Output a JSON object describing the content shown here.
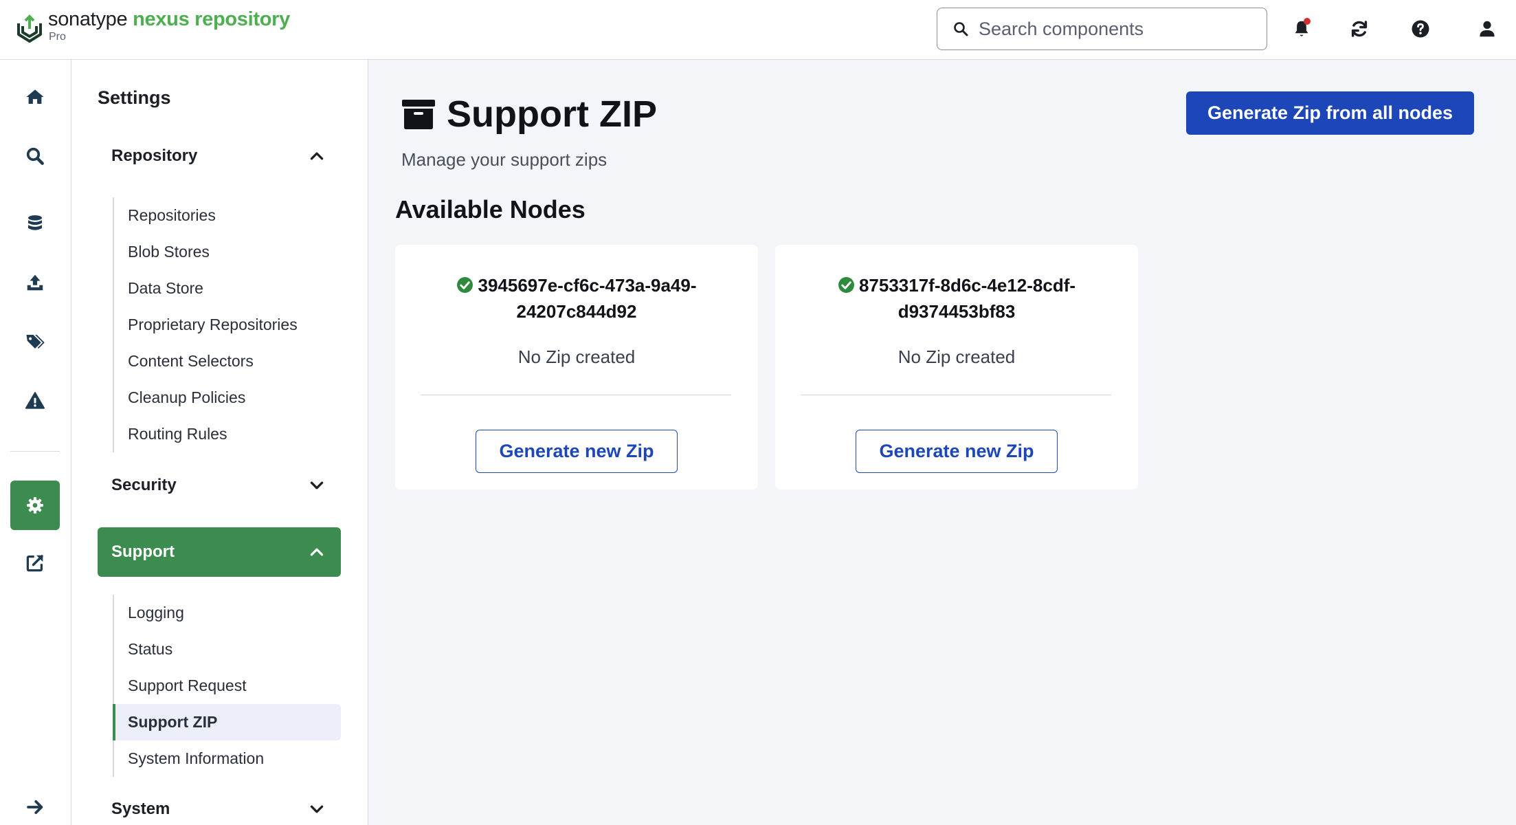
{
  "app": {
    "brand_part1": "sonatype",
    "brand_part2": "nexus repository",
    "edition": "Pro"
  },
  "header": {
    "search_placeholder": "Search components",
    "icons": [
      "bell-icon",
      "refresh-icon",
      "help-icon",
      "user-icon"
    ]
  },
  "rail": {
    "icons": [
      "home-icon",
      "search-icon",
      "database-icon",
      "upload-icon",
      "tags-icon",
      "warning-icon",
      "gear-icon",
      "external-link-icon",
      "arrow-right-icon"
    ],
    "active": "gear-icon"
  },
  "sidebar": {
    "title": "Settings",
    "groups": [
      {
        "label": "Repository",
        "expanded": true,
        "items": [
          "Repositories",
          "Blob Stores",
          "Data Store",
          "Proprietary Repositories",
          "Content Selectors",
          "Cleanup Policies",
          "Routing Rules"
        ]
      },
      {
        "label": "Security",
        "expanded": false
      },
      {
        "label": "Support",
        "expanded": true,
        "items": [
          "Logging",
          "Status",
          "Support Request",
          "Support ZIP",
          "System Information"
        ]
      },
      {
        "label": "System",
        "expanded": false
      }
    ],
    "active_item": "Support ZIP"
  },
  "main": {
    "title": "Support ZIP",
    "subtitle": "Manage your support zips",
    "generate_all_label": "Generate Zip from all nodes",
    "section_title": "Available Nodes",
    "nodes": [
      {
        "id_line1": "3945697e-cf6c-473a-9a49-",
        "id_line2": "24207c844d92",
        "status": "No Zip created",
        "button_label": "Generate new Zip"
      },
      {
        "id_line1": "8753317f-8d6c-4e12-8cdf-",
        "id_line2": "d9374453bf83",
        "status": "No Zip created",
        "button_label": "Generate new Zip"
      }
    ]
  },
  "colors": {
    "brand_green": "#4caf50",
    "active_green": "#3c8c50",
    "primary_blue": "#1d47b8",
    "background": "#f4f5f9",
    "notification_red": "#d32f2f",
    "success_green": "#2e8b3e"
  }
}
